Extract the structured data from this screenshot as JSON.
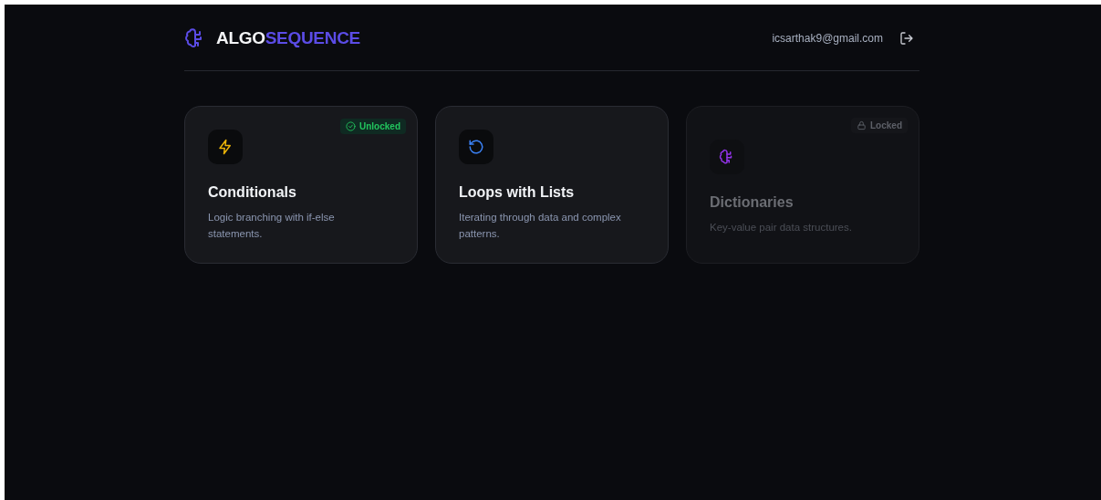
{
  "header": {
    "brand": {
      "part_1": "ALGO",
      "part_2": "SEQUENCE"
    },
    "user_email": "icsarthak9@gmail.com"
  },
  "cards": [
    {
      "kind": "bolt",
      "title": "Conditionals",
      "description": "Logic branching with if-else statements.",
      "status": "Unlocked",
      "locked": false
    },
    {
      "kind": "refresh",
      "title": "Loops with Lists",
      "description": "Iterating through data and complex patterns.",
      "locked": false
    },
    {
      "kind": "brain",
      "title": "Dictionaries",
      "description": "Key-value pair data structures.",
      "status": "Locked",
      "locked": true
    }
  ]
}
